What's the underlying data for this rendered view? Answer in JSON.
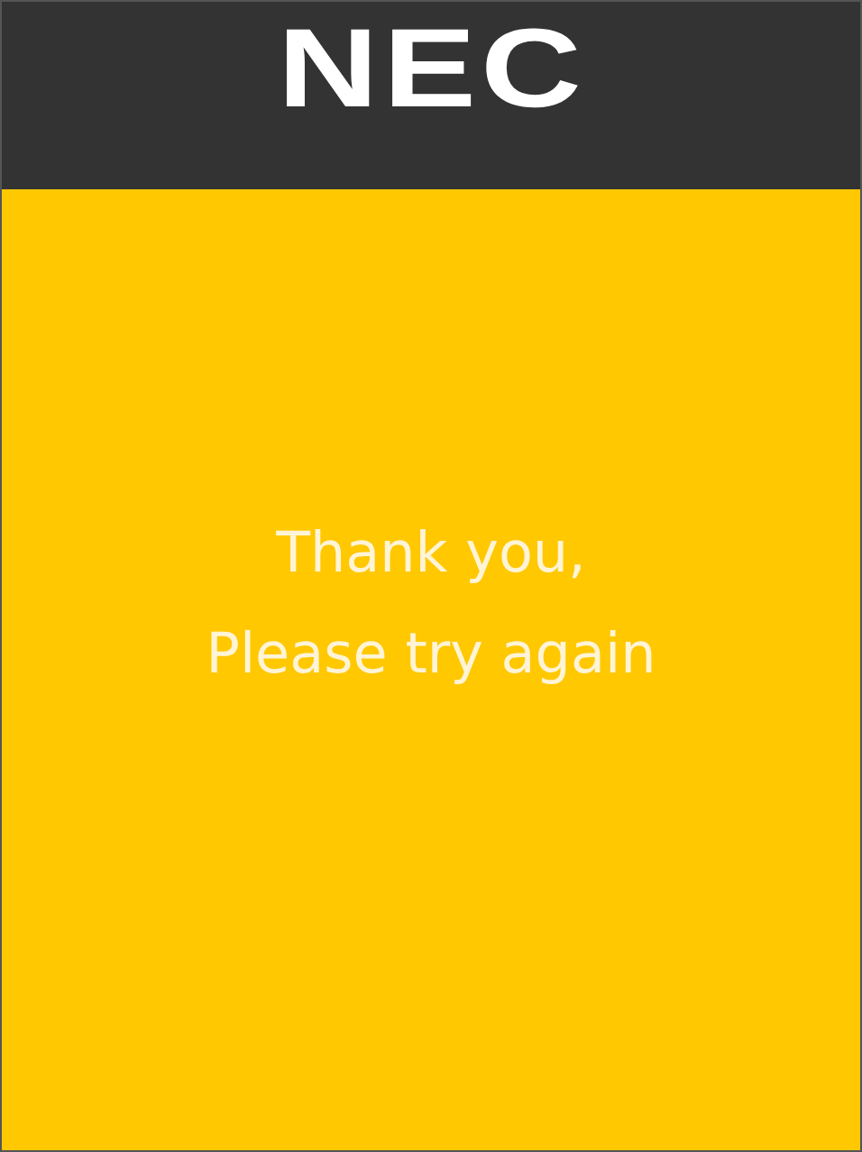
{
  "header": {
    "logo": "NEC"
  },
  "message": {
    "lines": [
      "Thank you,",
      "Please try again"
    ]
  }
}
